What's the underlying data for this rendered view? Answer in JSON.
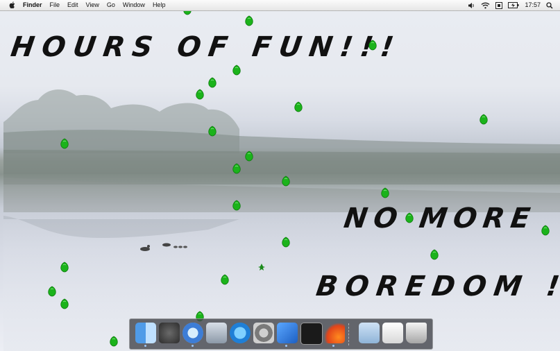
{
  "menubar": {
    "app_name": "Finder",
    "menus": [
      "File",
      "Edit",
      "View",
      "Go",
      "Window",
      "Help"
    ],
    "clock": "17:57",
    "icons": [
      "apple-icon",
      "volume-icon",
      "wifi-icon",
      "input-menu-icon",
      "battery-icon",
      "spotlight-icon"
    ]
  },
  "desktop": {
    "headlines": [
      "HOURS OF FUN!!!",
      "NO MORE",
      "BOREDOM !"
    ],
    "sprite_name": "green-leaf-icon",
    "sprite_color": "#1bb31b",
    "small_sprite_name": "little-green-figure-icon"
  },
  "dock": {
    "items": [
      "finder-icon",
      "dashboard-icon",
      "safari-icon",
      "mail-icon",
      "itunes-icon",
      "system-preferences-icon",
      "xcode-icon",
      "terminal-icon",
      "comet-app-icon",
      "applications-folder-icon",
      "preview-icon",
      "trash-icon"
    ]
  }
}
